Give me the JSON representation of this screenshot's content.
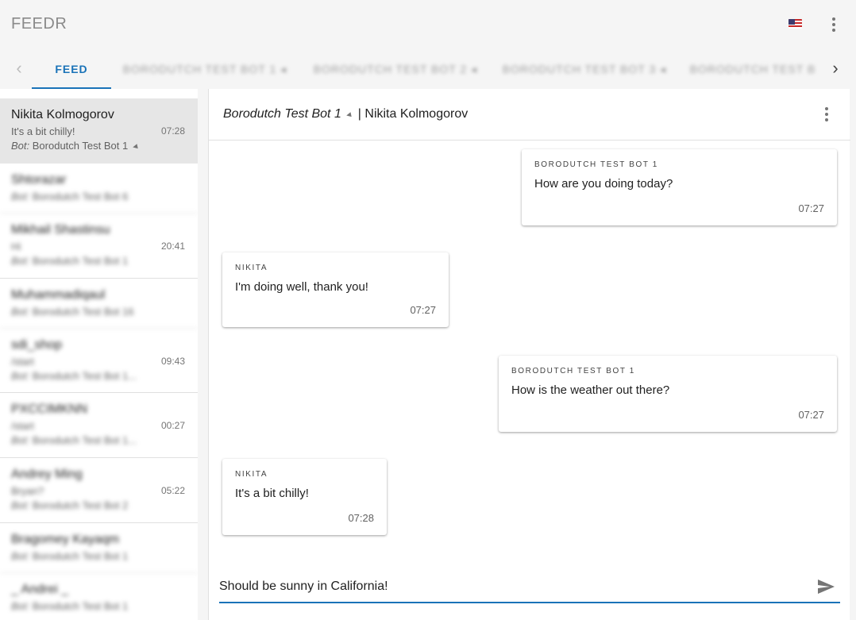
{
  "app": {
    "brand": "FEEDR",
    "language_flag": "us-flag-icon"
  },
  "tabs": {
    "items": [
      {
        "label": "FEED",
        "active": true
      },
      {
        "label": "BORODUTCH TEST BOT 1 ◂",
        "active": false
      },
      {
        "label": "BORODUTCH TEST BOT 2 ◂",
        "active": false
      },
      {
        "label": "BORODUTCH TEST BOT 3 ◂",
        "active": false
      },
      {
        "label": "BORODUTCH TEST B",
        "active": false
      }
    ],
    "prev_icon": "chevron-left-icon",
    "next_icon": "chevron-right-icon"
  },
  "sidebar": {
    "items": [
      {
        "name": "Nikita Kolmogorov",
        "message": "It's a bit chilly!",
        "bot_label": "Bot:",
        "bot_name": "Borodutch Test Bot 1",
        "time": "07:28",
        "selected": true
      },
      {
        "name": "Shtorazar",
        "message": "",
        "bot_label": "Bot:",
        "bot_name": "Borodutch Test Bot 6",
        "time": ""
      },
      {
        "name": "Mikhail Shastinsu",
        "message": "Hi",
        "bot_label": "Bot:",
        "bot_name": "Borodutch Test Bot 1",
        "time": "20:41"
      },
      {
        "name": "Muhammadiqaul",
        "message": "",
        "bot_label": "Bot:",
        "bot_name": "Borodutch Test Bot 16",
        "time": ""
      },
      {
        "name": "sdi_shop",
        "message": "/start",
        "bot_label": "Bot:",
        "bot_name": "Borodutch Test Bot 1...",
        "time": "09:43"
      },
      {
        "name": "PXCCIMKNN",
        "message": "/start",
        "bot_label": "Bot:",
        "bot_name": "Borodutch Test Bot 1...",
        "time": "00:27"
      },
      {
        "name": "Andrey Ming",
        "message": "Bryan?",
        "bot_label": "Bot:",
        "bot_name": "Borodutch Test Bot 2",
        "time": "05:22"
      },
      {
        "name": "Bragomey Kayaqm",
        "message": "",
        "bot_label": "Bot:",
        "bot_name": "Borodutch Test Bot 1",
        "time": ""
      },
      {
        "name": "_ Andrei _",
        "message": "",
        "bot_label": "Bot:",
        "bot_name": "Borodutch Test Bot 1",
        "time": ""
      }
    ]
  },
  "conversation": {
    "bot_name": "Borodutch Test Bot 1",
    "separator": "|",
    "user_name": "Nikita Kolmogorov",
    "messages": [
      {
        "sender": "BORODUTCH TEST BOT 1",
        "text": "How are you doing today?",
        "time": "07:27",
        "side": "right"
      },
      {
        "sender": "NIKITA",
        "text": "I'm doing well, thank you!",
        "time": "07:27",
        "side": "left"
      },
      {
        "sender": "BORODUTCH TEST BOT 1",
        "text": "How is the weather out there?",
        "time": "07:27",
        "side": "right"
      },
      {
        "sender": "NIKITA",
        "text": "It's a bit chilly!",
        "time": "07:28",
        "side": "left"
      }
    ]
  },
  "composer": {
    "value": "Should be sunny in California!",
    "send_icon": "send-icon"
  },
  "colors": {
    "accent": "#1a73b8",
    "selected_row": "#e6e6e6",
    "background": "#f5f5f5"
  }
}
